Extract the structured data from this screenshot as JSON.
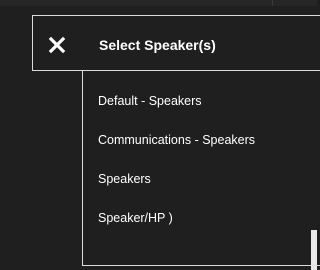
{
  "flyout": {
    "title": "Select Speaker(s)",
    "close_icon": "close-icon",
    "options": [
      "Default - Speakers",
      "Communications - Speakers",
      "Speakers",
      "Speaker/HP )"
    ]
  },
  "colors": {
    "background": "#1f1f1f",
    "text": "#ffffff",
    "border": "#dcdcdc"
  }
}
